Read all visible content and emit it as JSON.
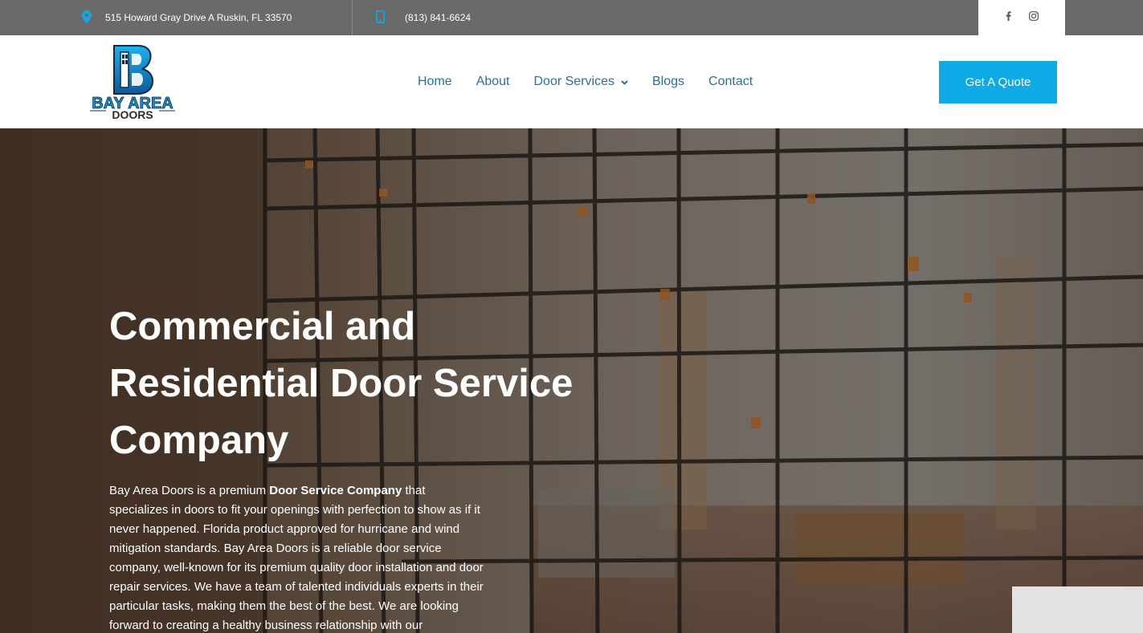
{
  "topbar": {
    "address": "515 Howard Gray Drive A Ruskin, FL 33570",
    "phone": "(813) 841-6624",
    "social": [
      {
        "icon": "facebook-icon",
        "label": "f"
      },
      {
        "icon": "instagram-icon"
      }
    ]
  },
  "logo": {
    "line1": "BAY AREA",
    "line2": "DOORS",
    "letter": "B"
  },
  "nav": {
    "items": [
      "Home",
      "About",
      "Door Services",
      "Blogs",
      "Contact"
    ],
    "cta": "Get A Quote"
  },
  "hero": {
    "title": "Commercial and Residential Door Service Company",
    "body_pre": "Bay Area Doors is a premium ",
    "body_bold": "Door Service Company",
    "body_post": " that specializes in doors to fit your openings with perfection to show as if it never happened. Florida product approved for hurricane and wind mitigation standards. Bay Area Doors is a reliable door service company, well-known for its premium quality door installation and door repair services. We have a team of talented individuals experts in their particular tasks, making them the best of the best. We are looking forward to creating a healthy business relationship with our"
  },
  "colors": {
    "topbar": "#6b6a6b",
    "nav_link": "#2a6f99",
    "accent": "#0fa9e6"
  }
}
